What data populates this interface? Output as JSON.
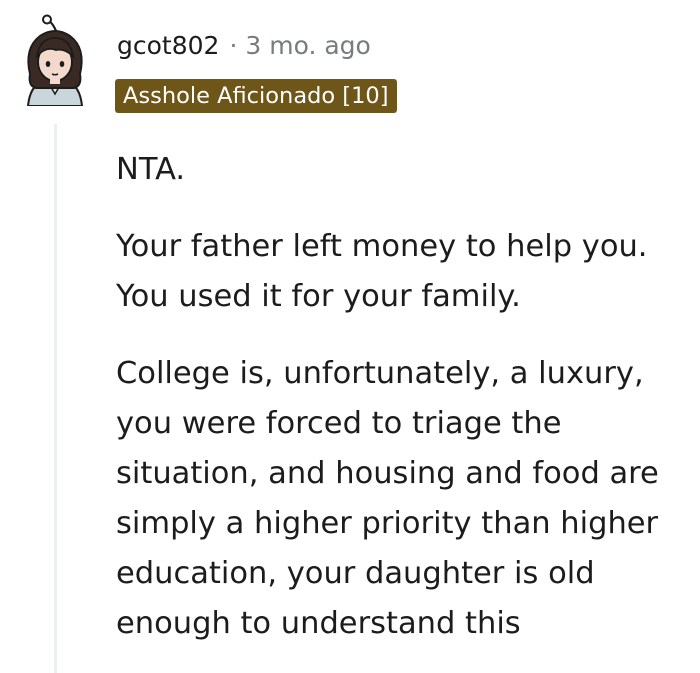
{
  "comment": {
    "username": "gcot802",
    "separator": "·",
    "timestamp": "3 mo. ago",
    "flair": "Asshole Aficionado [10]",
    "avatar_icon": "avatar-girl-dark-hair",
    "paragraphs": [
      [
        "NTA."
      ],
      [
        "Your father left money to help you.",
        "You used it for your family."
      ],
      [
        "College is, unfortunately, a luxury,",
        "you were forced to triage the",
        "situation, and housing and food are",
        "simply a higher priority than higher",
        "education, your daughter is old",
        "enough to understand this"
      ]
    ]
  },
  "colors": {
    "flair_background": "#6e5518",
    "flair_text": "#ffffff",
    "meta_gray": "#787c7e",
    "text": "#1c1c1c",
    "thread_line": "#edeff1"
  }
}
